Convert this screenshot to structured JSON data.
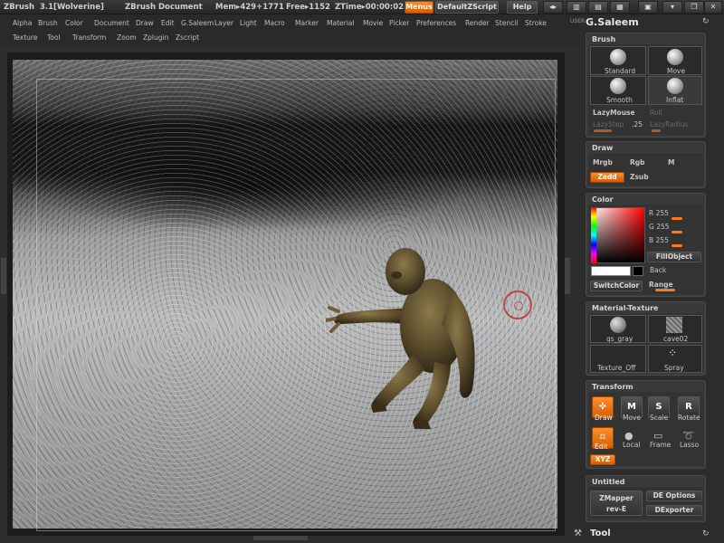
{
  "titlebar": {
    "app": "ZBrush",
    "version": "3.1[Wolverine]",
    "document": "ZBrush Document",
    "mem": "Mem▸429+1771",
    "free": "Free▸1152",
    "ztime": "ZTime▸00:00:02.",
    "menus_label": "Menus",
    "default_script": "DefaultZScript",
    "help_label": "Help"
  },
  "menubar": {
    "row1": [
      "Alpha",
      "Brush",
      "Color",
      "Document",
      "Draw",
      "Edit",
      "G.Saleem",
      "Layer",
      "Light",
      "Macro",
      "Marker",
      "Material",
      "Movie",
      "Picker",
      "Preferences",
      "Render",
      "Stencil",
      "Stroke"
    ],
    "row2": [
      "Texture",
      "Tool",
      "Transform",
      "Zoom",
      "Zplugin",
      "Zscript"
    ]
  },
  "panel": {
    "user_label": "USER",
    "title": "G.Saleem",
    "brush": {
      "title": "Brush",
      "standard": "Standard",
      "move": "Move",
      "smooth": "Smooth",
      "inflat": "Inflat",
      "lazymouse": "LazyMouse",
      "roll": "Roll",
      "lazystep": "LazyStep",
      "lazystep_value": ".25",
      "lazyradius": "LazyRadius"
    },
    "draw": {
      "title": "Draw",
      "mrgb": "Mrgb",
      "rgb": "Rgb",
      "m": "M",
      "zadd": "Zadd",
      "zsub": "Zsub"
    },
    "color": {
      "title": "Color",
      "r": "R 255",
      "g": "G 255",
      "b": "B 255",
      "fillobject": "FillObject",
      "back": "Back",
      "switchcolor": "SwitchColor",
      "range": "Range"
    },
    "material": {
      "title": "Material-Texture",
      "mat1": "qs_gray",
      "mat2": "cave02",
      "tex_off": "Texture_Off",
      "spray": "Spray"
    },
    "transform": {
      "title": "Transform",
      "draw": "Draw",
      "move": "Move",
      "scale": "Scale",
      "rotate": "Rotate",
      "edit": "Edit",
      "local": "Local",
      "frame": "Frame",
      "lasso": "Lasso",
      "xyz": "XYZ"
    },
    "untitled": {
      "title": "Untitled",
      "zmapper": "ZMapper",
      "zmapper_rev": "rev-E",
      "de_options": "DE Options",
      "dexporter": "DExporter"
    },
    "tool_label": "Tool"
  },
  "colors": {
    "accent": "#ff7a18",
    "panel_bg": "#3a3a3a"
  }
}
